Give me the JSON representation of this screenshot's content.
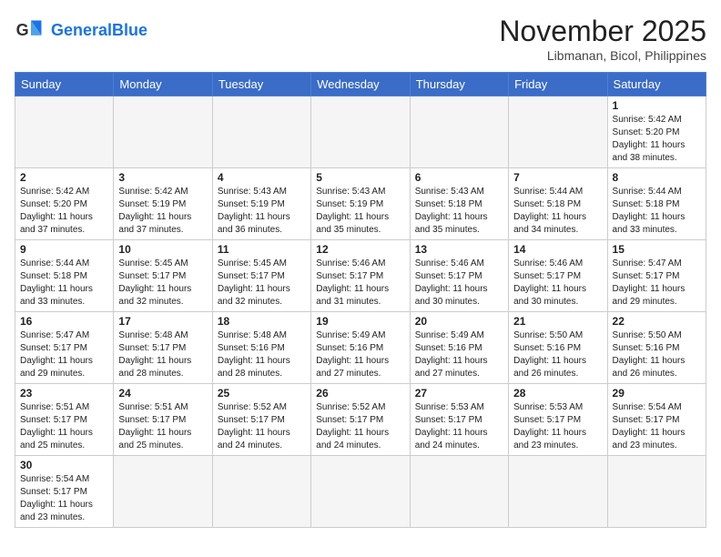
{
  "header": {
    "logo_general": "General",
    "logo_blue": "Blue",
    "month_title": "November 2025",
    "location": "Libmanan, Bicol, Philippines"
  },
  "weekdays": [
    "Sunday",
    "Monday",
    "Tuesday",
    "Wednesday",
    "Thursday",
    "Friday",
    "Saturday"
  ],
  "weeks": [
    [
      {
        "day": "",
        "sunrise": "",
        "sunset": "",
        "daylight": "",
        "empty": true
      },
      {
        "day": "",
        "sunrise": "",
        "sunset": "",
        "daylight": "",
        "empty": true
      },
      {
        "day": "",
        "sunrise": "",
        "sunset": "",
        "daylight": "",
        "empty": true
      },
      {
        "day": "",
        "sunrise": "",
        "sunset": "",
        "daylight": "",
        "empty": true
      },
      {
        "day": "",
        "sunrise": "",
        "sunset": "",
        "daylight": "",
        "empty": true
      },
      {
        "day": "",
        "sunrise": "",
        "sunset": "",
        "daylight": "",
        "empty": true
      },
      {
        "day": "1",
        "sunrise": "Sunrise: 5:42 AM",
        "sunset": "Sunset: 5:20 PM",
        "daylight": "Daylight: 11 hours and 38 minutes.",
        "empty": false
      }
    ],
    [
      {
        "day": "2",
        "sunrise": "Sunrise: 5:42 AM",
        "sunset": "Sunset: 5:20 PM",
        "daylight": "Daylight: 11 hours and 37 minutes.",
        "empty": false
      },
      {
        "day": "3",
        "sunrise": "Sunrise: 5:42 AM",
        "sunset": "Sunset: 5:19 PM",
        "daylight": "Daylight: 11 hours and 37 minutes.",
        "empty": false
      },
      {
        "day": "4",
        "sunrise": "Sunrise: 5:43 AM",
        "sunset": "Sunset: 5:19 PM",
        "daylight": "Daylight: 11 hours and 36 minutes.",
        "empty": false
      },
      {
        "day": "5",
        "sunrise": "Sunrise: 5:43 AM",
        "sunset": "Sunset: 5:19 PM",
        "daylight": "Daylight: 11 hours and 35 minutes.",
        "empty": false
      },
      {
        "day": "6",
        "sunrise": "Sunrise: 5:43 AM",
        "sunset": "Sunset: 5:18 PM",
        "daylight": "Daylight: 11 hours and 35 minutes.",
        "empty": false
      },
      {
        "day": "7",
        "sunrise": "Sunrise: 5:44 AM",
        "sunset": "Sunset: 5:18 PM",
        "daylight": "Daylight: 11 hours and 34 minutes.",
        "empty": false
      },
      {
        "day": "8",
        "sunrise": "Sunrise: 5:44 AM",
        "sunset": "Sunset: 5:18 PM",
        "daylight": "Daylight: 11 hours and 33 minutes.",
        "empty": false
      }
    ],
    [
      {
        "day": "9",
        "sunrise": "Sunrise: 5:44 AM",
        "sunset": "Sunset: 5:18 PM",
        "daylight": "Daylight: 11 hours and 33 minutes.",
        "empty": false
      },
      {
        "day": "10",
        "sunrise": "Sunrise: 5:45 AM",
        "sunset": "Sunset: 5:17 PM",
        "daylight": "Daylight: 11 hours and 32 minutes.",
        "empty": false
      },
      {
        "day": "11",
        "sunrise": "Sunrise: 5:45 AM",
        "sunset": "Sunset: 5:17 PM",
        "daylight": "Daylight: 11 hours and 32 minutes.",
        "empty": false
      },
      {
        "day": "12",
        "sunrise": "Sunrise: 5:46 AM",
        "sunset": "Sunset: 5:17 PM",
        "daylight": "Daylight: 11 hours and 31 minutes.",
        "empty": false
      },
      {
        "day": "13",
        "sunrise": "Sunrise: 5:46 AM",
        "sunset": "Sunset: 5:17 PM",
        "daylight": "Daylight: 11 hours and 30 minutes.",
        "empty": false
      },
      {
        "day": "14",
        "sunrise": "Sunrise: 5:46 AM",
        "sunset": "Sunset: 5:17 PM",
        "daylight": "Daylight: 11 hours and 30 minutes.",
        "empty": false
      },
      {
        "day": "15",
        "sunrise": "Sunrise: 5:47 AM",
        "sunset": "Sunset: 5:17 PM",
        "daylight": "Daylight: 11 hours and 29 minutes.",
        "empty": false
      }
    ],
    [
      {
        "day": "16",
        "sunrise": "Sunrise: 5:47 AM",
        "sunset": "Sunset: 5:17 PM",
        "daylight": "Daylight: 11 hours and 29 minutes.",
        "empty": false
      },
      {
        "day": "17",
        "sunrise": "Sunrise: 5:48 AM",
        "sunset": "Sunset: 5:17 PM",
        "daylight": "Daylight: 11 hours and 28 minutes.",
        "empty": false
      },
      {
        "day": "18",
        "sunrise": "Sunrise: 5:48 AM",
        "sunset": "Sunset: 5:16 PM",
        "daylight": "Daylight: 11 hours and 28 minutes.",
        "empty": false
      },
      {
        "day": "19",
        "sunrise": "Sunrise: 5:49 AM",
        "sunset": "Sunset: 5:16 PM",
        "daylight": "Daylight: 11 hours and 27 minutes.",
        "empty": false
      },
      {
        "day": "20",
        "sunrise": "Sunrise: 5:49 AM",
        "sunset": "Sunset: 5:16 PM",
        "daylight": "Daylight: 11 hours and 27 minutes.",
        "empty": false
      },
      {
        "day": "21",
        "sunrise": "Sunrise: 5:50 AM",
        "sunset": "Sunset: 5:16 PM",
        "daylight": "Daylight: 11 hours and 26 minutes.",
        "empty": false
      },
      {
        "day": "22",
        "sunrise": "Sunrise: 5:50 AM",
        "sunset": "Sunset: 5:16 PM",
        "daylight": "Daylight: 11 hours and 26 minutes.",
        "empty": false
      }
    ],
    [
      {
        "day": "23",
        "sunrise": "Sunrise: 5:51 AM",
        "sunset": "Sunset: 5:17 PM",
        "daylight": "Daylight: 11 hours and 25 minutes.",
        "empty": false
      },
      {
        "day": "24",
        "sunrise": "Sunrise: 5:51 AM",
        "sunset": "Sunset: 5:17 PM",
        "daylight": "Daylight: 11 hours and 25 minutes.",
        "empty": false
      },
      {
        "day": "25",
        "sunrise": "Sunrise: 5:52 AM",
        "sunset": "Sunset: 5:17 PM",
        "daylight": "Daylight: 11 hours and 24 minutes.",
        "empty": false
      },
      {
        "day": "26",
        "sunrise": "Sunrise: 5:52 AM",
        "sunset": "Sunset: 5:17 PM",
        "daylight": "Daylight: 11 hours and 24 minutes.",
        "empty": false
      },
      {
        "day": "27",
        "sunrise": "Sunrise: 5:53 AM",
        "sunset": "Sunset: 5:17 PM",
        "daylight": "Daylight: 11 hours and 24 minutes.",
        "empty": false
      },
      {
        "day": "28",
        "sunrise": "Sunrise: 5:53 AM",
        "sunset": "Sunset: 5:17 PM",
        "daylight": "Daylight: 11 hours and 23 minutes.",
        "empty": false
      },
      {
        "day": "29",
        "sunrise": "Sunrise: 5:54 AM",
        "sunset": "Sunset: 5:17 PM",
        "daylight": "Daylight: 11 hours and 23 minutes.",
        "empty": false
      }
    ],
    [
      {
        "day": "30",
        "sunrise": "Sunrise: 5:54 AM",
        "sunset": "Sunset: 5:17 PM",
        "daylight": "Daylight: 11 hours and 23 minutes.",
        "empty": false
      },
      {
        "day": "",
        "sunrise": "",
        "sunset": "",
        "daylight": "",
        "empty": true
      },
      {
        "day": "",
        "sunrise": "",
        "sunset": "",
        "daylight": "",
        "empty": true
      },
      {
        "day": "",
        "sunrise": "",
        "sunset": "",
        "daylight": "",
        "empty": true
      },
      {
        "day": "",
        "sunrise": "",
        "sunset": "",
        "daylight": "",
        "empty": true
      },
      {
        "day": "",
        "sunrise": "",
        "sunset": "",
        "daylight": "",
        "empty": true
      },
      {
        "day": "",
        "sunrise": "",
        "sunset": "",
        "daylight": "",
        "empty": true
      }
    ]
  ]
}
